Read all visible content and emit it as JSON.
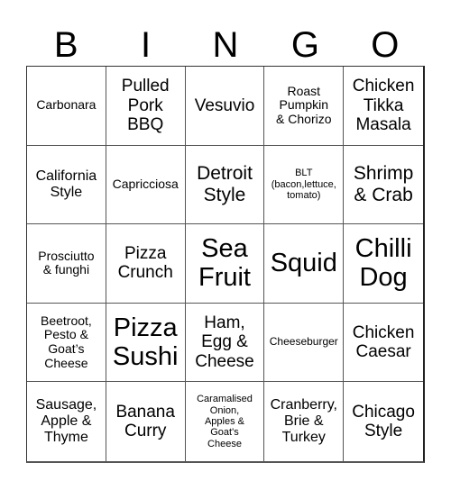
{
  "header": {
    "letters": [
      "B",
      "I",
      "N",
      "G",
      "O"
    ]
  },
  "card": {
    "cells": [
      {
        "text": "Carbonara",
        "size": "s-sm"
      },
      {
        "text": "Pulled\nPork\nBBQ",
        "size": "s-lg"
      },
      {
        "text": "Vesuvio",
        "size": "s-lg"
      },
      {
        "text": "Roast\nPumpkin\n& Chorizo",
        "size": "s-sm"
      },
      {
        "text": "Chicken\nTikka\nMasala",
        "size": "s-lg"
      },
      {
        "text": "California\nStyle",
        "size": "s-md"
      },
      {
        "text": "Capricciosa",
        "size": "s-sm"
      },
      {
        "text": "Detroit\nStyle",
        "size": "s-xl"
      },
      {
        "text": "BLT\n(bacon,lettuce,\ntomato)",
        "size": "s-xxs"
      },
      {
        "text": "Shrimp\n& Crab",
        "size": "s-xl"
      },
      {
        "text": "Prosciutto\n& funghi",
        "size": "s-sm"
      },
      {
        "text": "Pizza\nCrunch",
        "size": "s-lg"
      },
      {
        "text": "Sea\nFruit",
        "size": "s-xxl"
      },
      {
        "text": "Squid",
        "size": "s-xxl"
      },
      {
        "text": "Chilli\nDog",
        "size": "s-xxl"
      },
      {
        "text": "Beetroot,\nPesto &\nGoat’s\nCheese",
        "size": "s-sm"
      },
      {
        "text": "Pizza\nSushi",
        "size": "s-xxl"
      },
      {
        "text": "Ham,\nEgg &\nCheese",
        "size": "s-lg"
      },
      {
        "text": "Cheeseburger",
        "size": "s-xs"
      },
      {
        "text": "Chicken\nCaesar",
        "size": "s-lg"
      },
      {
        "text": "Sausage,\nApple &\nThyme",
        "size": "s-md"
      },
      {
        "text": "Banana\nCurry",
        "size": "s-lg"
      },
      {
        "text": "Caramalised\nOnion,\nApples &\nGoat's\nCheese",
        "size": "s-xxs"
      },
      {
        "text": "Cranberry,\nBrie &\nTurkey",
        "size": "s-md"
      },
      {
        "text": "Chicago\nStyle",
        "size": "s-lg"
      }
    ]
  }
}
